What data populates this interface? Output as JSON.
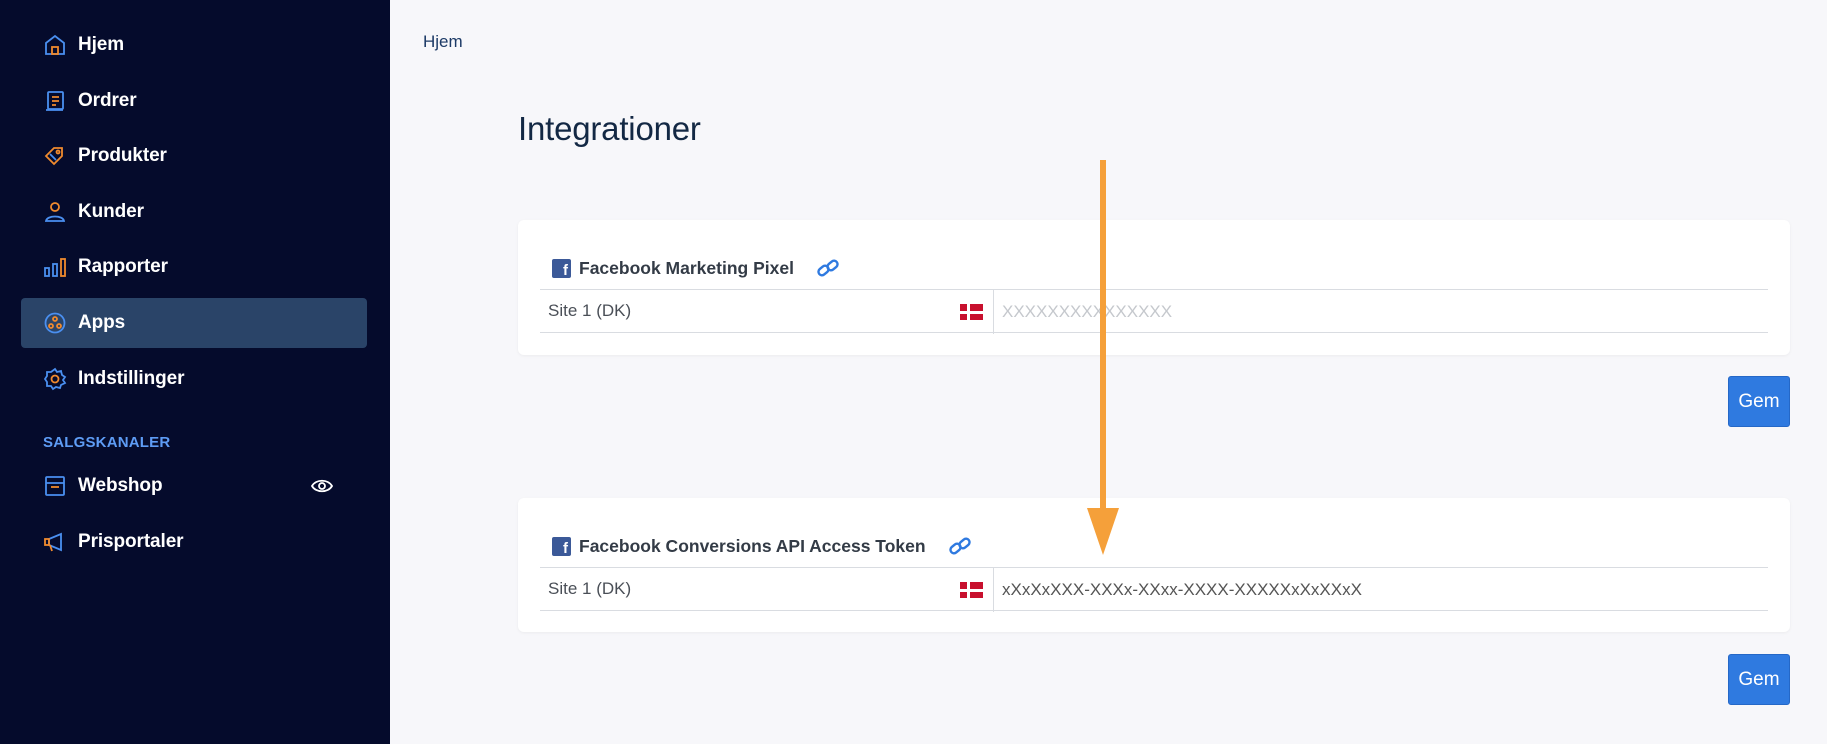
{
  "sidebar": {
    "items": [
      {
        "label": "Hjem",
        "icon": "home-icon"
      },
      {
        "label": "Ordrer",
        "icon": "orders-icon"
      },
      {
        "label": "Produkter",
        "icon": "tag-icon"
      },
      {
        "label": "Kunder",
        "icon": "user-icon"
      },
      {
        "label": "Rapporter",
        "icon": "bar-chart-icon"
      },
      {
        "label": "Apps",
        "icon": "apps-icon",
        "active": true
      },
      {
        "label": "Indstillinger",
        "icon": "gear-icon"
      }
    ],
    "section_label": "SALGSKANALER",
    "channels": [
      {
        "label": "Webshop",
        "icon": "store-icon",
        "extra_icon": "eye-icon"
      },
      {
        "label": "Prisportaler",
        "icon": "megaphone-icon"
      }
    ]
  },
  "breadcrumb": "Hjem",
  "page_title": "Integrationer",
  "cards": [
    {
      "title": "Facebook Marketing Pixel",
      "row_label": "Site 1 (DK)",
      "field_value": "",
      "field_placeholder": "XXXXXXXXXXXXXXX",
      "button": "Gem"
    },
    {
      "title": "Facebook Conversions API Access Token",
      "row_label": "Site 1 (DK)",
      "field_value": "xXxXxXXX-XXXx-XXxx-XXXX-XXXXXxXxXXxX",
      "field_placeholder": "",
      "button": "Gem"
    }
  ],
  "colors": {
    "sidebar_bg": "#050b2c",
    "active_bg": "#2a4468",
    "icon_blue": "#4a8ff0",
    "icon_orange": "#f08a2e",
    "button_blue": "#2f7ae0",
    "arrow_orange": "#f5a03a"
  }
}
